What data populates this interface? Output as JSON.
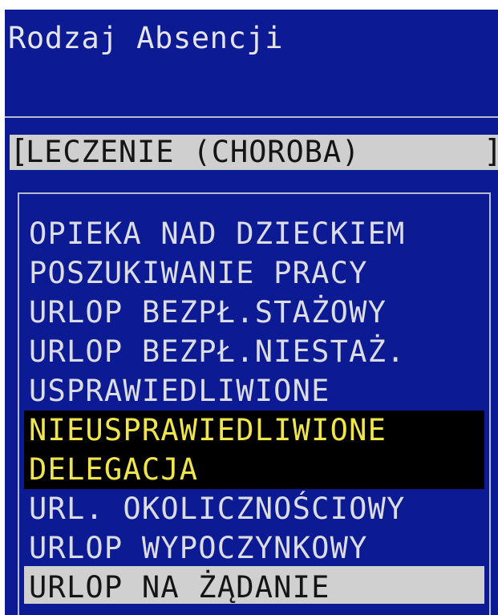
{
  "window": {
    "title": "Rodzaj Absencji"
  },
  "selected_field": {
    "bracket_open": "[",
    "value": "LECZENIE (CHOROBA)",
    "bracket_close": "]"
  },
  "list": {
    "items": [
      {
        "label": "OPIEKA NAD DZIECKIEM",
        "state": "normal"
      },
      {
        "label": "POSZUKIWANIE PRACY",
        "state": "normal"
      },
      {
        "label": "URLOP BEZPŁ.STAŻOWY",
        "state": "normal"
      },
      {
        "label": "URLOP BEZPŁ.NIESTAŻ.",
        "state": "normal"
      },
      {
        "label": "USPRAWIEDLIWIONE",
        "state": "normal"
      },
      {
        "label": "NIEUSPRAWIEDLIWIONE",
        "state": "highlighted"
      },
      {
        "label": "DELEGACJA",
        "state": "highlighted"
      },
      {
        "label": "URL. OKOLICZNOŚCIOWY",
        "state": "normal"
      },
      {
        "label": "URLOP WYPOCZYNKOWY",
        "state": "normal"
      },
      {
        "label": "URLOP NA ŻĄDANIE",
        "state": "cursor"
      }
    ]
  },
  "colors": {
    "background": "#0c1b93",
    "text": "#dcdce4",
    "highlight_bg": "#000000",
    "highlight_text": "#f0e64c",
    "cursor_bg": "#d0d0d0",
    "cursor_text": "#151515",
    "field_bg": "#cfcfcf"
  }
}
